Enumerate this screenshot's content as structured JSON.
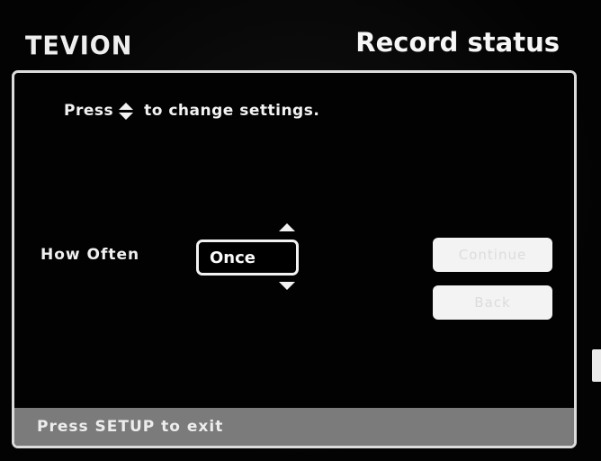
{
  "header": {
    "brand": "TEVION",
    "title": "Record status"
  },
  "instruction": {
    "prefix": "Press",
    "icon": "up-down-arrows-icon",
    "suffix": "to change settings."
  },
  "setting": {
    "label": "How Often",
    "value": "Once",
    "icon_up": "up-arrow-icon",
    "icon_down": "down-arrow-icon"
  },
  "buttons": {
    "continue_label": "Continue",
    "back_label": "Back"
  },
  "footer": {
    "hint": "Press SETUP to exit"
  },
  "colors": {
    "background": "#050505",
    "panel_border": "#dcdcdc",
    "text": "#f4f4f4",
    "button_bg": "#f3f3f3",
    "footer_bg": "#7b7b7b"
  }
}
